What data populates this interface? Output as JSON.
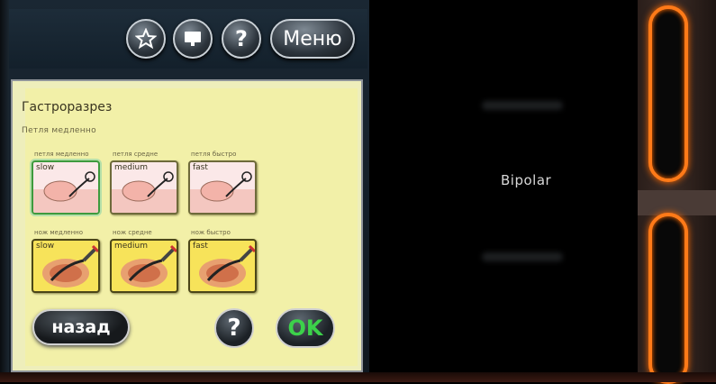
{
  "header": {
    "menu_label": "Меню",
    "buttons": [
      "star-icon",
      "monitor-icon",
      "help-icon"
    ]
  },
  "dialog": {
    "title": "Гастроразрез",
    "subtitle": "Петля медленно",
    "loop_row": [
      {
        "label": "петля медленно",
        "tag": "slow",
        "selected": true
      },
      {
        "label": "петля средне",
        "tag": "medium",
        "selected": false
      },
      {
        "label": "петля быстро",
        "tag": "fast",
        "selected": false
      }
    ],
    "knife_row": [
      {
        "label": "нож медленно",
        "tag": "slow"
      },
      {
        "label": "нож средне",
        "tag": "medium"
      },
      {
        "label": "нож быстро",
        "tag": "fast"
      }
    ],
    "back_label": "назад",
    "help_label": "?",
    "ok_label": "OK"
  },
  "right_display": {
    "mode_label": "Bipolar"
  },
  "colors": {
    "accent_orange": "#ff7a18",
    "ok_green": "#3cd14a",
    "panel_yellow": "#f2f0a8"
  }
}
